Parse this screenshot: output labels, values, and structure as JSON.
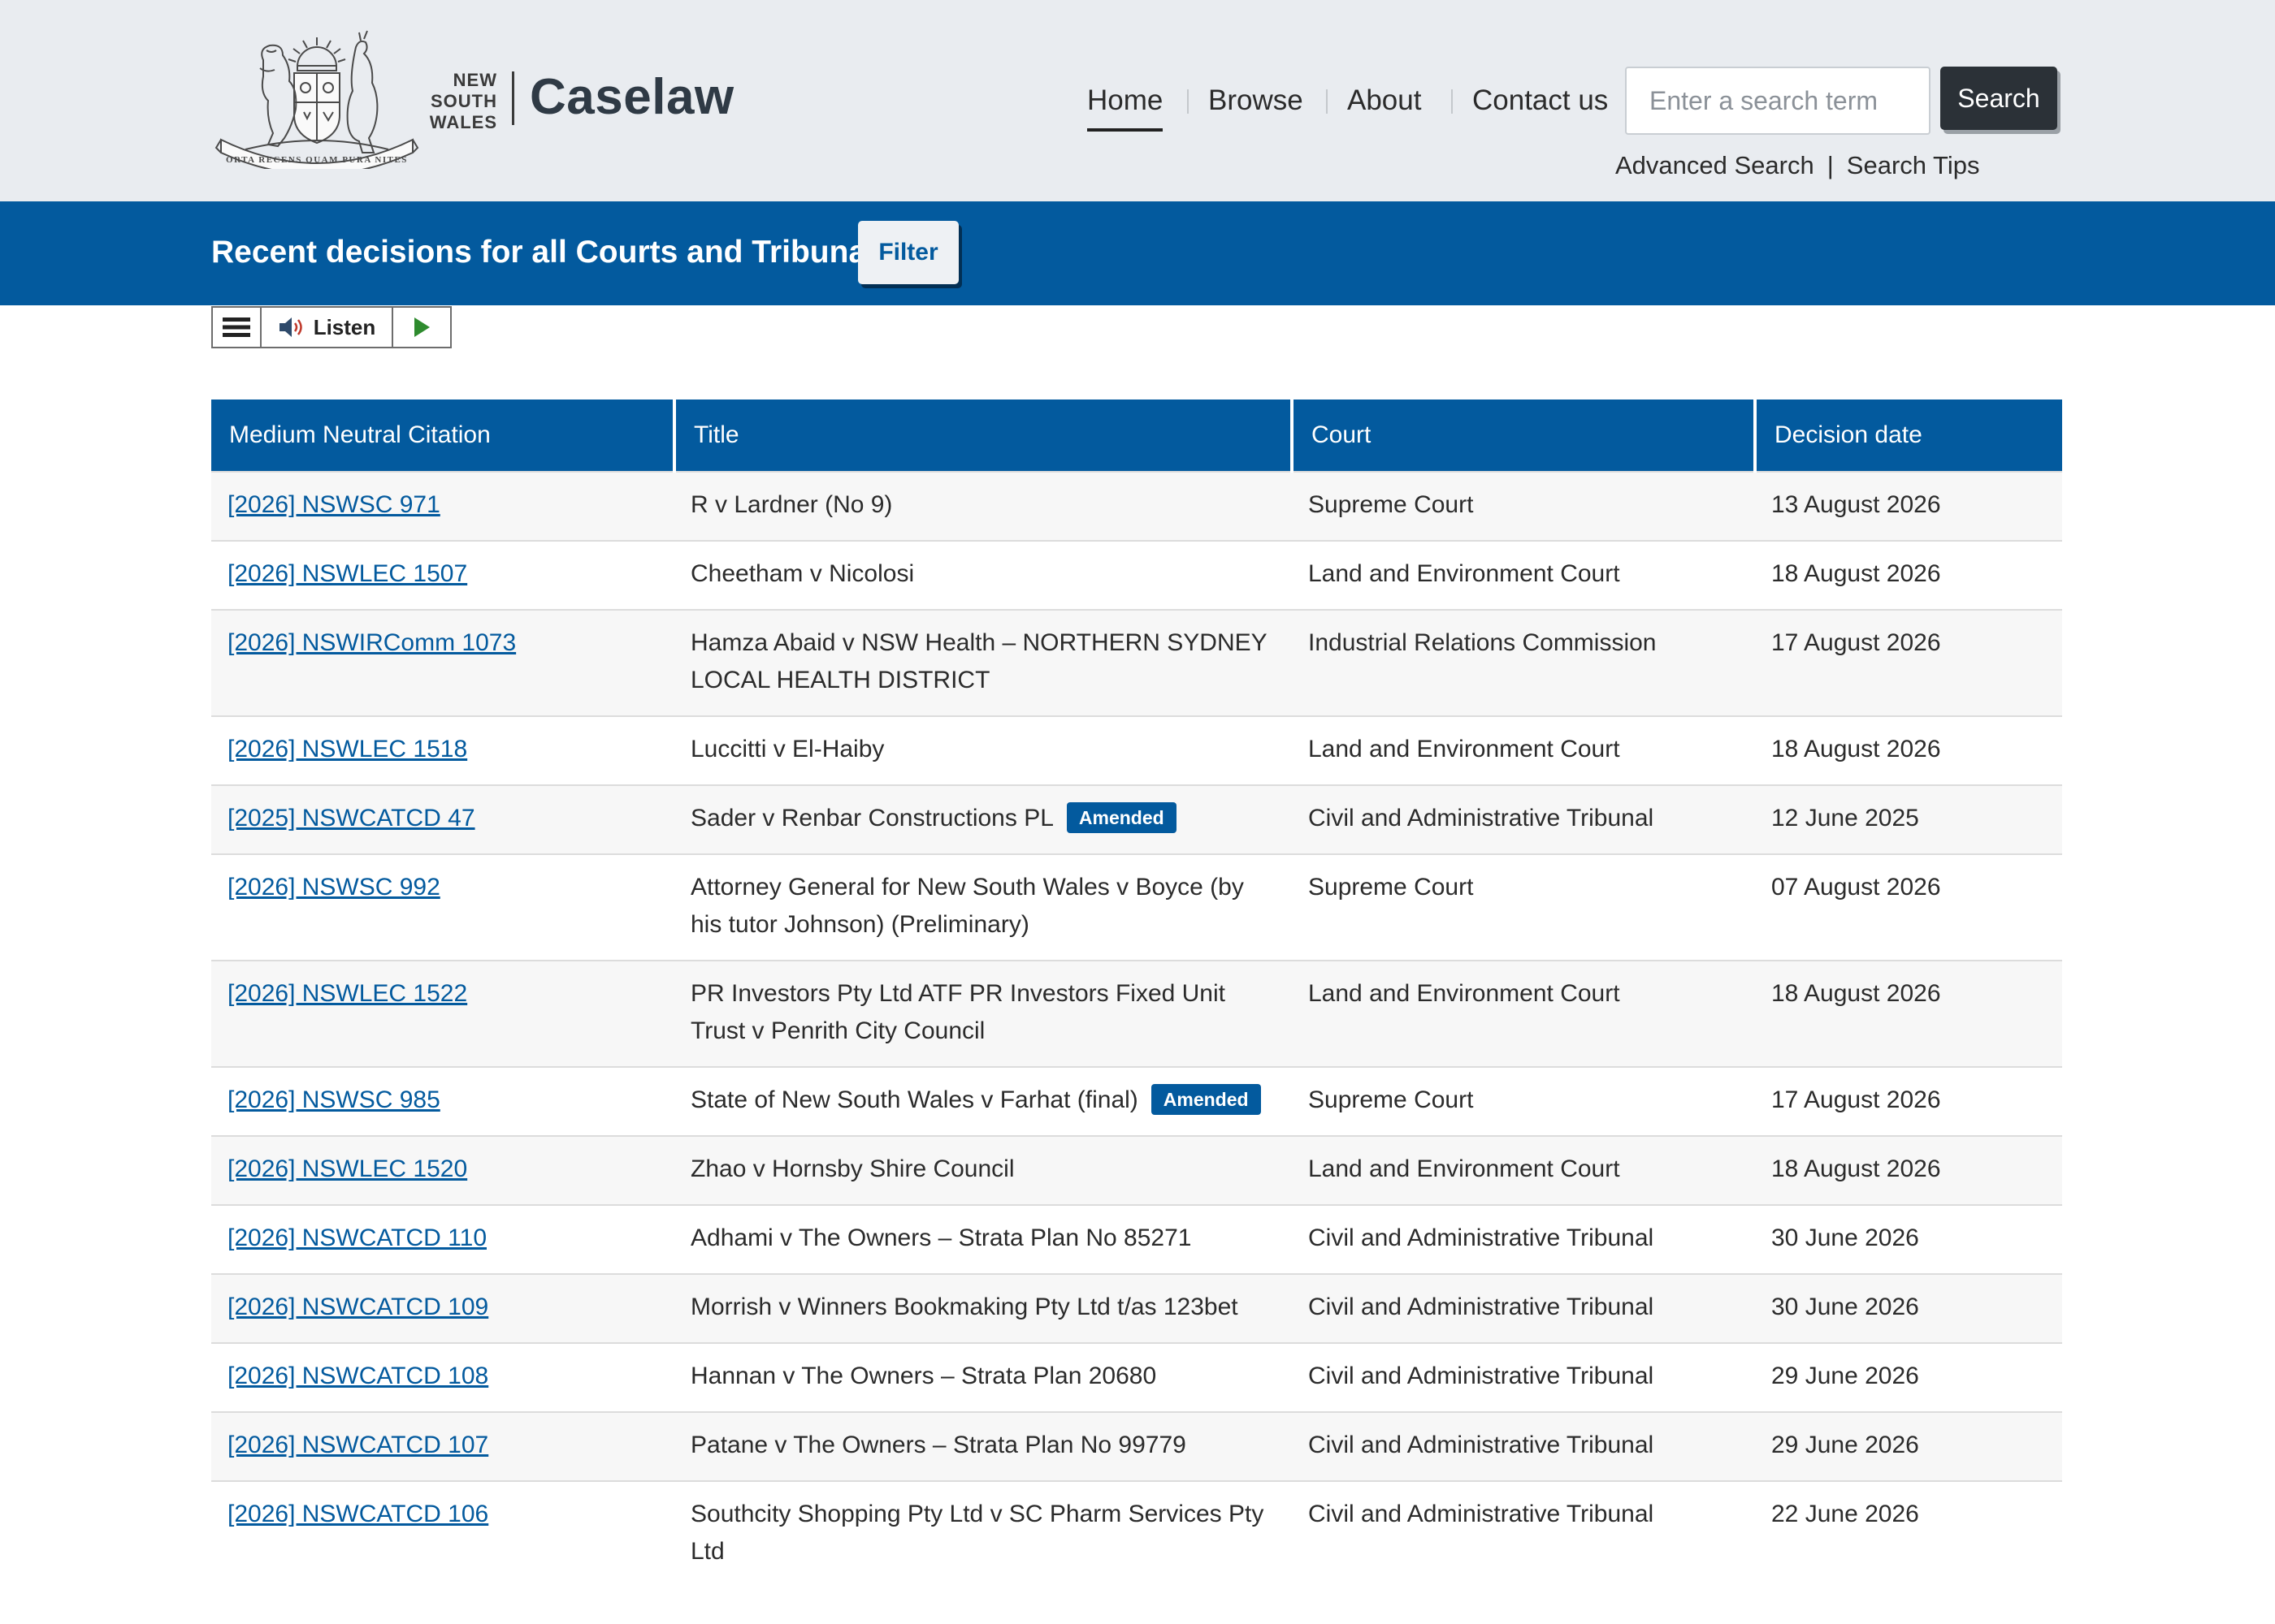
{
  "brand": {
    "state_lines": [
      "NEW",
      "SOUTH",
      "WALES"
    ],
    "name": "Caselaw",
    "crest_motto": "ORTA RECENS QUAM PURA NITES"
  },
  "nav": {
    "items": [
      {
        "label": "Home",
        "active": true
      },
      {
        "label": "Browse",
        "active": false
      },
      {
        "label": "About",
        "active": false
      },
      {
        "label": "Contact us",
        "active": false
      }
    ]
  },
  "search": {
    "placeholder": "Enter a search term",
    "value": "",
    "button_label": "Search",
    "advanced_label": "Advanced Search",
    "tips_label": "Search Tips"
  },
  "banner": {
    "title": "Recent decisions for all Courts and Tribunals",
    "filter_label": "Filter"
  },
  "listen": {
    "label": "Listen",
    "menu_icon": "hamburger-menu-icon",
    "speaker_icon": "speaker-icon",
    "play_icon": "play-icon"
  },
  "colors": {
    "primary": "#035a9e",
    "header_bg": "#e9ecf0",
    "search_button": "#2b3137"
  },
  "table": {
    "columns": [
      "Medium Neutral Citation",
      "Title",
      "Court",
      "Decision date"
    ],
    "rows": [
      {
        "citation": "[2026] NSWSC 971",
        "title": "R v Lardner (No 9)",
        "badge": "",
        "court": "Supreme Court",
        "date": "13 August 2026"
      },
      {
        "citation": "[2026] NSWLEC 1507",
        "title": "Cheetham v Nicolosi",
        "badge": "",
        "court": "Land and Environment Court",
        "date": "18 August 2026"
      },
      {
        "citation": "[2026] NSWIRComm 1073",
        "title": "Hamza Abaid v NSW Health – NORTHERN SYDNEY LOCAL HEALTH DISTRICT",
        "badge": "",
        "court": "Industrial Relations Commission",
        "date": "17 August 2026"
      },
      {
        "citation": "[2026] NSWLEC 1518",
        "title": "Luccitti v El-Haiby",
        "badge": "",
        "court": "Land and Environment Court",
        "date": "18 August 2026"
      },
      {
        "citation": "[2025] NSWCATCD 47",
        "title": "Sader v Renbar Constructions PL",
        "badge": "Amended",
        "court": "Civil and Administrative Tribunal",
        "date": "12 June 2025"
      },
      {
        "citation": "[2026] NSWSC 992",
        "title": "Attorney General for New South Wales v Boyce (by his tutor Johnson) (Preliminary)",
        "badge": "",
        "court": "Supreme Court",
        "date": "07 August 2026"
      },
      {
        "citation": "[2026] NSWLEC 1522",
        "title": "PR Investors Pty Ltd ATF PR Investors Fixed Unit Trust v Penrith City Council",
        "badge": "",
        "court": "Land and Environment Court",
        "date": "18 August 2026"
      },
      {
        "citation": "[2026] NSWSC 985",
        "title": "State of New South Wales v Farhat (final)",
        "badge": "Amended",
        "court": "Supreme Court",
        "date": "17 August 2026"
      },
      {
        "citation": "[2026] NSWLEC 1520",
        "title": "Zhao v Hornsby Shire Council",
        "badge": "",
        "court": "Land and Environment Court",
        "date": "18 August 2026"
      },
      {
        "citation": "[2026] NSWCATCD 110",
        "title": "Adhami v The Owners – Strata Plan No 85271",
        "badge": "",
        "court": "Civil and Administrative Tribunal",
        "date": "30 June 2026"
      },
      {
        "citation": "[2026] NSWCATCD 109",
        "title": "Morrish v Winners Bookmaking Pty Ltd t/as 123bet",
        "badge": "",
        "court": "Civil and Administrative Tribunal",
        "date": "30 June 2026"
      },
      {
        "citation": "[2026] NSWCATCD 108",
        "title": "Hannan v The Owners – Strata Plan 20680",
        "badge": "",
        "court": "Civil and Administrative Tribunal",
        "date": "29 June 2026"
      },
      {
        "citation": "[2026] NSWCATCD 107",
        "title": "Patane v The Owners – Strata Plan No 99779",
        "badge": "",
        "court": "Civil and Administrative Tribunal",
        "date": "29 June 2026"
      },
      {
        "citation": "[2026] NSWCATCD 106",
        "title": "Southcity Shopping Pty Ltd v SC Pharm Services Pty Ltd",
        "badge": "",
        "court": "Civil and Administrative Tribunal",
        "date": "22 June 2026"
      }
    ]
  }
}
